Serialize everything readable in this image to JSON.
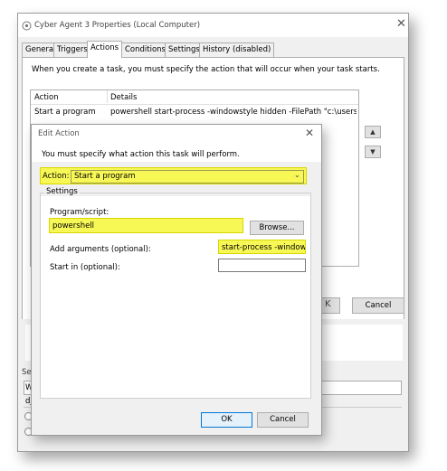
{
  "outer_window": {
    "title": "Cyber Agent 3 Properties (Local Computer)",
    "close_glyph": "✕",
    "tabs": [
      "General",
      "Triggers",
      "Actions",
      "Conditions",
      "Settings",
      "History (disabled)"
    ],
    "active_tab": "Actions",
    "description": "When you create a task, you must specify the action that will occur when your task starts.",
    "table": {
      "columns": [
        "Action",
        "Details"
      ],
      "rows": [
        {
          "action": "Start a program",
          "details": "powershell start-process -windowstyle hidden -FilePath \"c:\\users\\djordan."
        }
      ]
    },
    "cancel_label": "Cancel",
    "partial_labels": {
      "sec": "Sec",
      "wh": "Wh",
      "djo": "djo"
    }
  },
  "edit_action": {
    "title": "Edit Action",
    "close_glyph": "✕",
    "description": "You must specify what action this task will perform.",
    "action_label": "Action:",
    "action_value": "Start a program",
    "settings_label": "Settings",
    "program_label": "Program/script:",
    "program_value": "powershell",
    "browse_label": "Browse...",
    "arguments_label": "Add arguments (optional):",
    "arguments_value": "start-process -windowsty",
    "start_in_label": "Start in (optional):",
    "start_in_value": "",
    "ok_label": "OK",
    "cancel_label": "Cancel"
  },
  "colors": {
    "highlight": "#f7f756",
    "ok_border": "#0078d7"
  },
  "icons": [
    "app-icon",
    "close-icon",
    "chevron-down-icon",
    "arrow-up-icon",
    "arrow-down-icon",
    "scroll-down-icon"
  ]
}
